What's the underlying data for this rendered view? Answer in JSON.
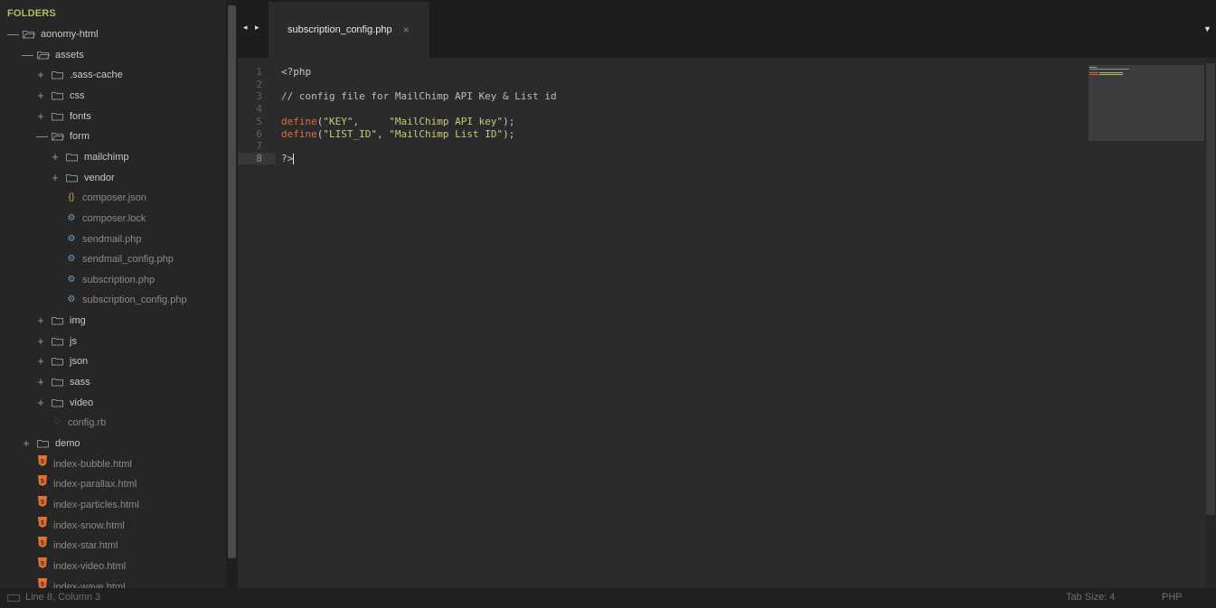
{
  "sidebar": {
    "title": "FOLDERS",
    "tree": [
      {
        "label": "aonomy-html",
        "kind": "folder",
        "open": true,
        "depth": 0
      },
      {
        "label": "assets",
        "kind": "folder",
        "open": true,
        "depth": 1
      },
      {
        "label": ".sass-cache",
        "kind": "folder",
        "open": false,
        "depth": 2
      },
      {
        "label": "css",
        "kind": "folder",
        "open": false,
        "depth": 2
      },
      {
        "label": "fonts",
        "kind": "folder",
        "open": false,
        "depth": 2
      },
      {
        "label": "form",
        "kind": "folder",
        "open": true,
        "depth": 2
      },
      {
        "label": "mailchimp",
        "kind": "folder",
        "open": false,
        "depth": 3
      },
      {
        "label": "vendor",
        "kind": "folder",
        "open": false,
        "depth": 3
      },
      {
        "label": "composer.json",
        "kind": "file",
        "icon": "json-braces-icon",
        "depth": 3
      },
      {
        "label": "composer.lock",
        "kind": "file",
        "icon": "gear-icon",
        "depth": 3
      },
      {
        "label": "sendmail.php",
        "kind": "file",
        "icon": "gear-icon",
        "depth": 3
      },
      {
        "label": "sendmail_config.php",
        "kind": "file",
        "icon": "gear-icon",
        "depth": 3
      },
      {
        "label": "subscription.php",
        "kind": "file",
        "icon": "gear-icon",
        "depth": 3
      },
      {
        "label": "subscription_config.php",
        "kind": "file",
        "icon": "gear-icon",
        "depth": 3
      },
      {
        "label": "img",
        "kind": "folder",
        "open": false,
        "depth": 2
      },
      {
        "label": "js",
        "kind": "folder",
        "open": false,
        "depth": 2
      },
      {
        "label": "json",
        "kind": "folder",
        "open": false,
        "depth": 2
      },
      {
        "label": "sass",
        "kind": "folder",
        "open": false,
        "depth": 2
      },
      {
        "label": "video",
        "kind": "folder",
        "open": false,
        "depth": 2
      },
      {
        "label": "config.rb",
        "kind": "file",
        "icon": "ruby-icon",
        "depth": 2
      },
      {
        "label": "demo",
        "kind": "folder",
        "open": false,
        "depth": 1
      },
      {
        "label": "index-bubble.html",
        "kind": "file",
        "icon": "html5-icon",
        "depth": 1
      },
      {
        "label": "index-parallax.html",
        "kind": "file",
        "icon": "html5-icon",
        "depth": 1
      },
      {
        "label": "index-particles.html",
        "kind": "file",
        "icon": "html5-icon",
        "depth": 1
      },
      {
        "label": "index-snow.html",
        "kind": "file",
        "icon": "html5-icon",
        "depth": 1
      },
      {
        "label": "index-star.html",
        "kind": "file",
        "icon": "html5-icon",
        "depth": 1
      },
      {
        "label": "index-video.html",
        "kind": "file",
        "icon": "html5-icon",
        "depth": 1
      },
      {
        "label": "index-wave.html",
        "kind": "file",
        "icon": "html5-icon",
        "depth": 1
      }
    ]
  },
  "tabs": {
    "nav_arrows": "◂ ▸",
    "active_tab": {
      "title": "subscription_config.php",
      "close_symbol": "×"
    },
    "menu_symbol": "▼"
  },
  "editor": {
    "line_numbers": [
      "1",
      "2",
      "3",
      "4",
      "5",
      "6",
      "7",
      "8"
    ],
    "current_line": 8,
    "code": [
      [
        {
          "t": "<?php",
          "c": "plain"
        }
      ],
      [],
      [
        {
          "t": "// config file for MailChimp API Key & List id",
          "c": "cmt"
        }
      ],
      [],
      [
        {
          "t": "define",
          "c": "kw"
        },
        {
          "t": "(",
          "c": "plain"
        },
        {
          "t": "\"KEY\"",
          "c": "str"
        },
        {
          "t": ",     ",
          "c": "plain"
        },
        {
          "t": "\"MailChimp API key\"",
          "c": "str"
        },
        {
          "t": ");",
          "c": "plain"
        }
      ],
      [
        {
          "t": "define",
          "c": "kw"
        },
        {
          "t": "(",
          "c": "plain"
        },
        {
          "t": "\"LIST_ID\"",
          "c": "str"
        },
        {
          "t": ", ",
          "c": "plain"
        },
        {
          "t": "\"MailChimp List ID\"",
          "c": "str"
        },
        {
          "t": ");",
          "c": "plain"
        }
      ],
      [],
      [
        {
          "t": "?>",
          "c": "plain"
        }
      ]
    ]
  },
  "status": {
    "position": "Line 8, Column 3",
    "tab_size": "Tab Size: 4",
    "syntax": "PHP"
  },
  "colors": {
    "folders_title": "#a6c160",
    "keyword": "#e06c3c",
    "string": "#c9c97a",
    "html5_icon": "#e2712c",
    "json_icon": "#d9a441",
    "gear_icon": "#6b9fcf",
    "ruby_icon": "#d03a3a"
  }
}
